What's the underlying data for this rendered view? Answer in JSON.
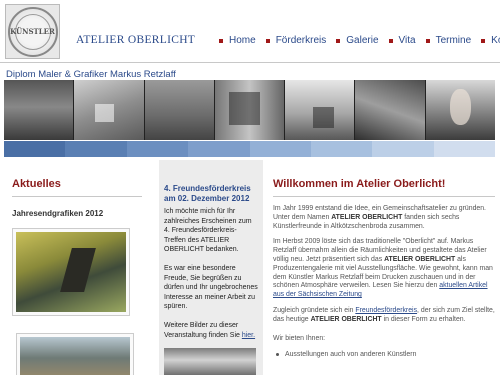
{
  "header": {
    "logo_text": "KÜNSTLER",
    "site_title": "ATELIER OBERLICHT",
    "nav": [
      {
        "label": "Home"
      },
      {
        "label": "Förderkreis"
      },
      {
        "label": "Galerie"
      },
      {
        "label": "Vita"
      },
      {
        "label": "Termine"
      },
      {
        "label": "Kontakt"
      }
    ],
    "accent_color": "#a01818",
    "link_color": "#2b4a8a"
  },
  "subtitle": "Diplom Maler & Grafiker Markus Retzlaff",
  "blue_bar_colors": [
    "#4a6fa5",
    "#5a7fb3",
    "#6c8fc0",
    "#7e9ecb",
    "#93b0d6",
    "#a7c0df",
    "#bccfe7",
    "#d1ddee"
  ],
  "left": {
    "title": "Aktuelles",
    "subheading": "Jahresendgrafiken 2012"
  },
  "middle": {
    "title": "4. Freundesförderkreis am 02. Dezember 2012",
    "para1": "Ich möchte mich für Ihr zahlreiches Erscheinen zum 4. Freundesförderkreis-Treffen des ATELIER OBERLICHT bedanken.",
    "para2": "Es war eine besondere Freude, Sie begrüßen zu dürfen und Ihr ungebrochenes Interesse an meiner Arbeit zu spüren.",
    "para3_text": "Weitere Bilder zu dieser Veranstaltung finden Sie",
    "para3_link": "hier."
  },
  "main": {
    "title": "Willkommen im Atelier Oberlicht!",
    "p1_a": "Im Jahr 1999 entstand die Idee, ein Gemeinschaftsatelier zu gründen. Unter dem Namen",
    "p1_b": "ATELIER OBERLICHT",
    "p1_c": "fanden sich sechs Künstlerfreunde in Altkötzschenbroda zusammen.",
    "p2_a": "Im Herbst 2009 löste sich das traditionelle \"Oberlicht\" auf. Markus Retzlaff übernahm allein die Räumlichkeiten und gestaltete das Atelier völlig neu. Jetzt präsentiert sich das",
    "p2_b": "ATELIER OBERLICHT",
    "p2_c": "als Produzentengalerie mit viel Ausstellungsfläche. Wie gewohnt, kann man dem Künstler Markus Retzlaff beim Drucken zuschauen und in der schönen Atmosphäre verweilen. Lesen Sie hierzu den",
    "p2_link": "aktuellen Artikel aus der Sächsischen Zeitung",
    "p3_a": "Zugleich gründete sich ein",
    "p3_link": "Freundesförderkreis",
    "p3_b": ", der sich zum Ziel stellte, das heutige",
    "p3_c": "ATELIER OBERLICHT",
    "p3_d": "in dieser Form zu erhalten.",
    "offer_heading": "Wir bieten Ihnen:",
    "bullet1": "Ausstellungen auch von anderen Künstlern"
  }
}
